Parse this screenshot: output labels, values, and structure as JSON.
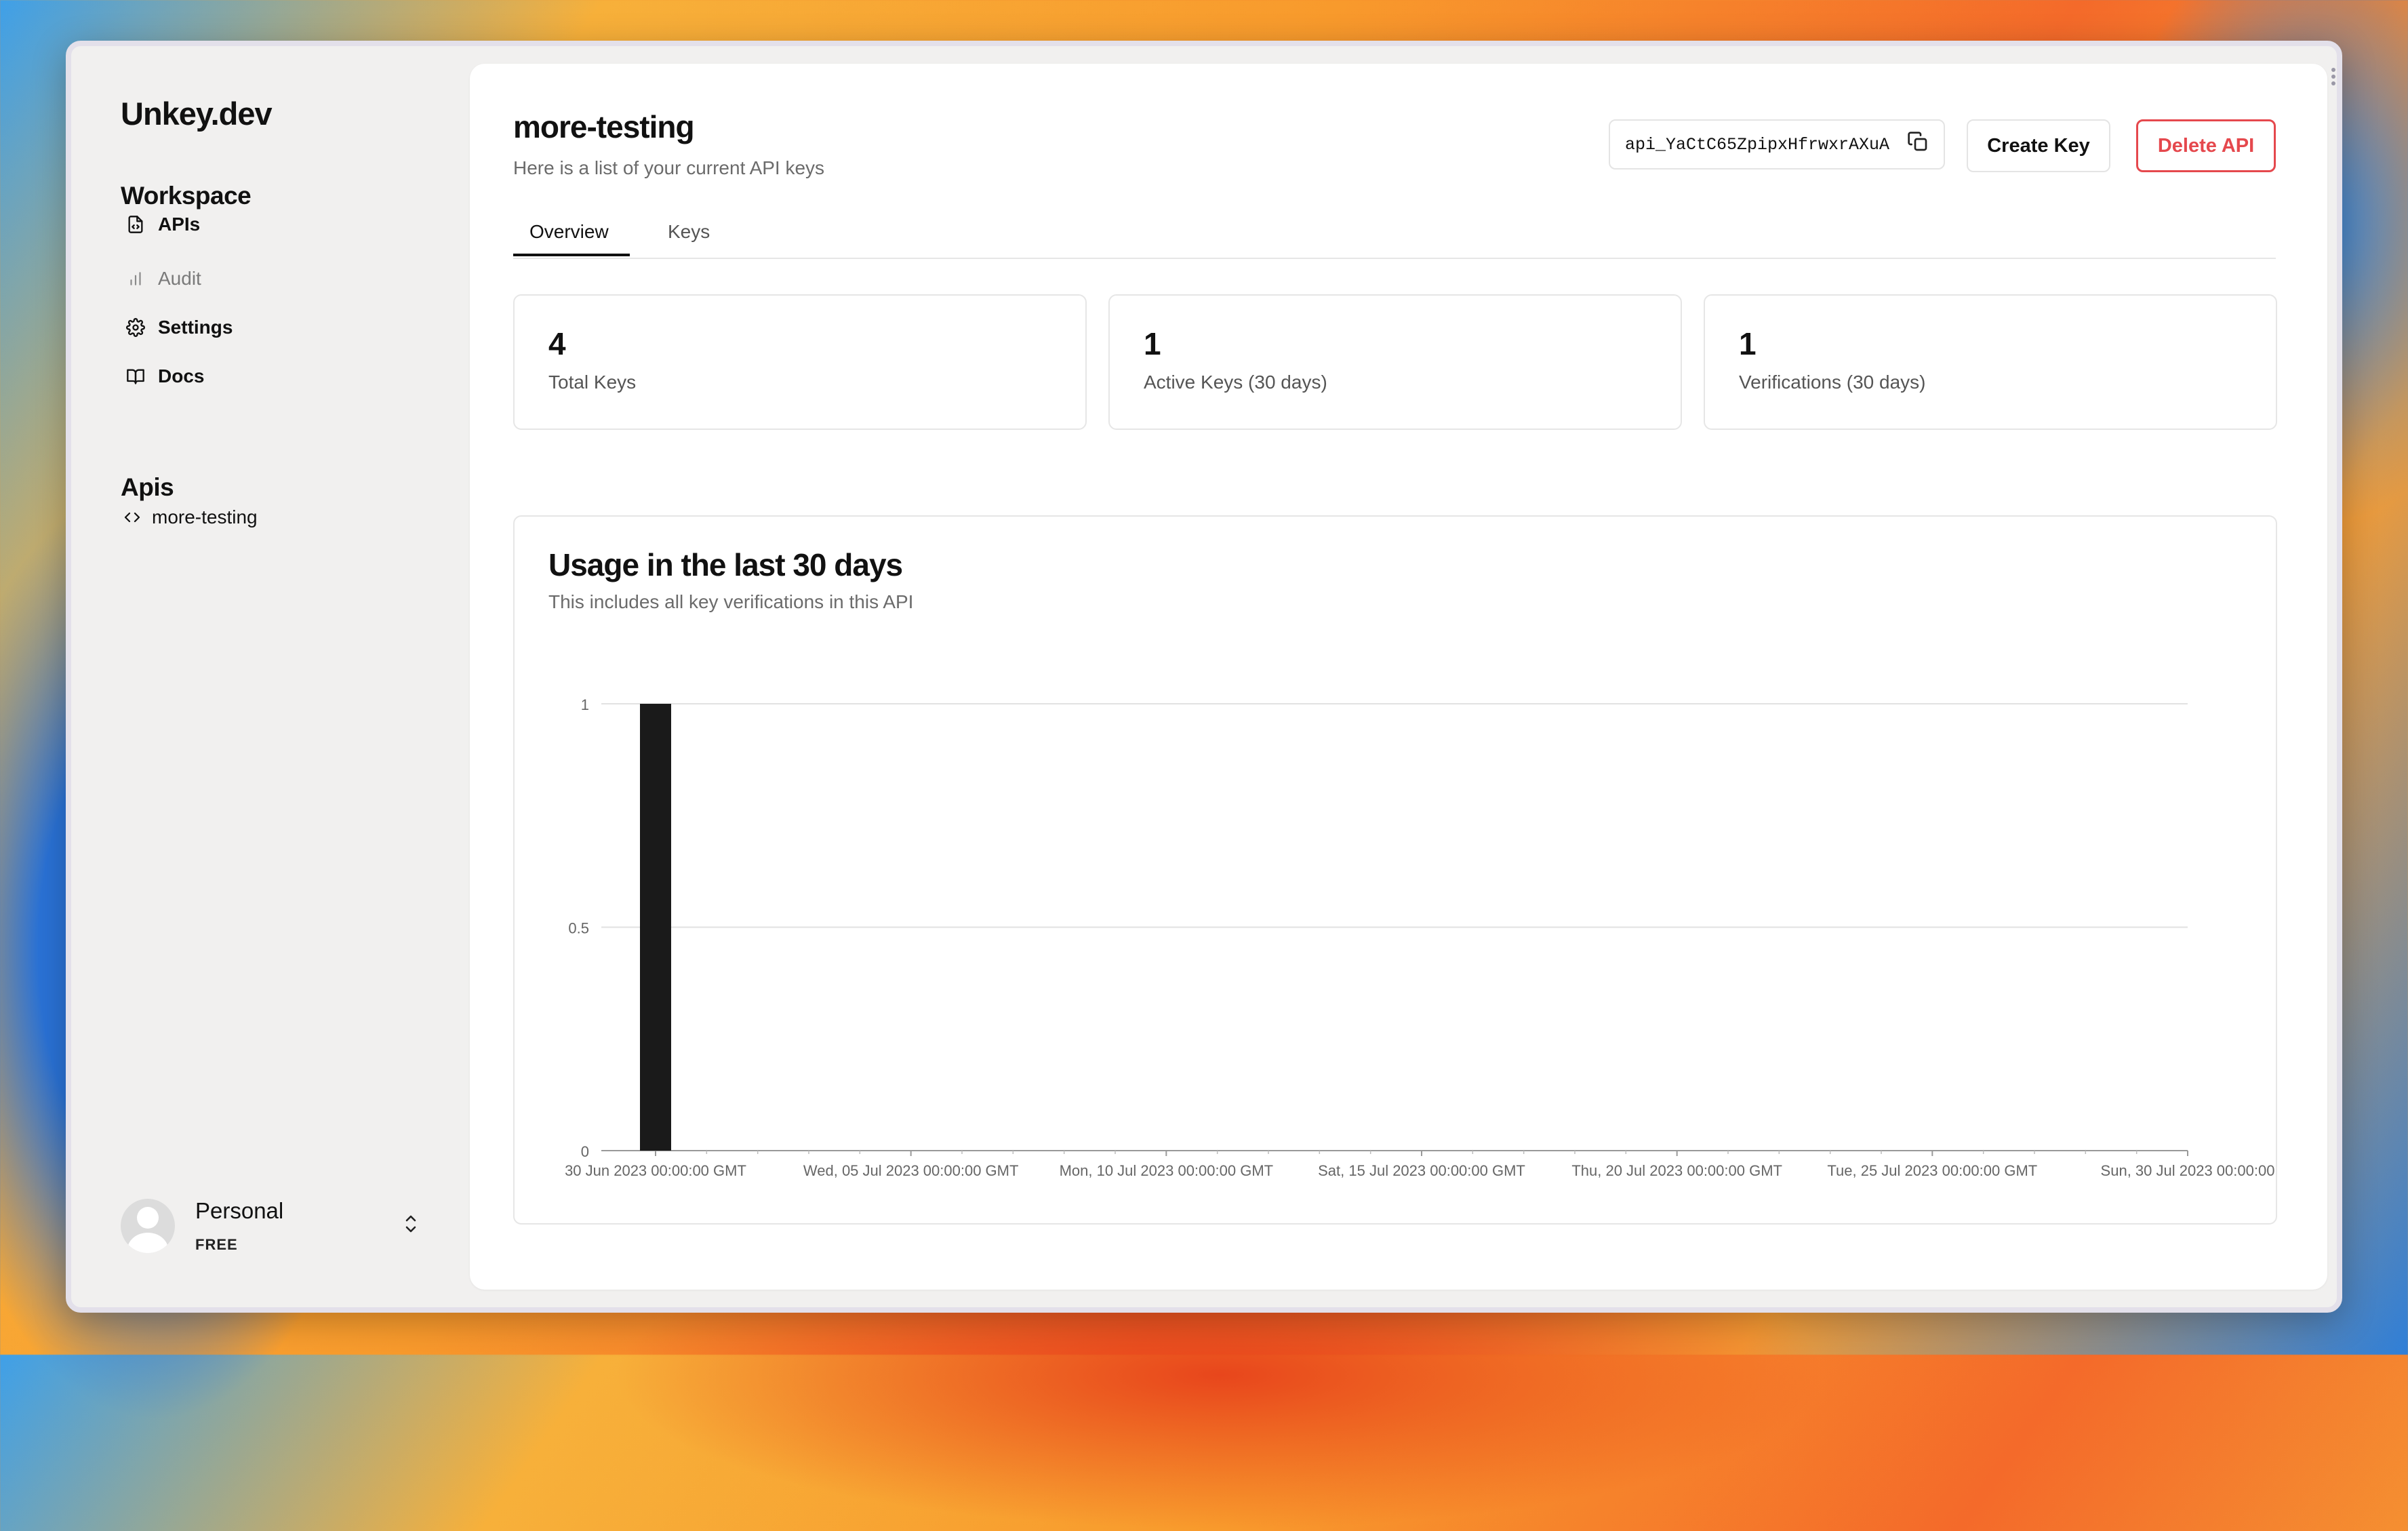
{
  "sidebar": {
    "logo": "Unkey.dev",
    "workspace_title": "Workspace",
    "nav": [
      {
        "label": "APIs",
        "icon": "file-code-icon"
      },
      {
        "label": "Audit",
        "icon": "bar-chart-icon"
      },
      {
        "label": "Settings",
        "icon": "gear-icon"
      },
      {
        "label": "Docs",
        "icon": "book-open-icon"
      }
    ],
    "apis_title": "Apis",
    "apis": [
      {
        "label": "more-testing",
        "icon": "code-brackets-icon"
      }
    ],
    "profile": {
      "name": "Personal",
      "plan": "FREE"
    }
  },
  "header": {
    "title": "more-testing",
    "subtitle": "Here is a list of your current API keys",
    "api_id": "api_YaCtC65ZpipxHfrwxrAXuA",
    "create_key": "Create Key",
    "delete_api": "Delete API"
  },
  "tabs": [
    {
      "label": "Overview",
      "active": true
    },
    {
      "label": "Keys",
      "active": false
    }
  ],
  "stats": [
    {
      "value": "4",
      "label": "Total Keys"
    },
    {
      "value": "1",
      "label": "Active Keys (30 days)"
    },
    {
      "value": "1",
      "label": "Verifications (30 days)"
    }
  ],
  "usage": {
    "title": "Usage in the last 30 days",
    "subtitle": "This includes all key verifications in this API"
  },
  "colors": {
    "accent_danger": "#e5484d",
    "bar": "#1a1a1a",
    "text": "#111111"
  },
  "chart_data": {
    "type": "bar",
    "x": [
      "30 Jun 2023",
      "01 Jul 2023",
      "02 Jul 2023",
      "03 Jul 2023",
      "04 Jul 2023",
      "05 Jul 2023",
      "06 Jul 2023",
      "07 Jul 2023",
      "08 Jul 2023",
      "09 Jul 2023",
      "10 Jul 2023",
      "11 Jul 2023",
      "12 Jul 2023",
      "13 Jul 2023",
      "14 Jul 2023",
      "15 Jul 2023",
      "16 Jul 2023",
      "17 Jul 2023",
      "18 Jul 2023",
      "19 Jul 2023",
      "20 Jul 2023",
      "21 Jul 2023",
      "22 Jul 2023",
      "23 Jul 2023",
      "24 Jul 2023",
      "25 Jul 2023",
      "26 Jul 2023",
      "27 Jul 2023",
      "28 Jul 2023",
      "29 Jul 2023",
      "30 Jul 2023"
    ],
    "values": [
      1,
      0,
      0,
      0,
      0,
      0,
      0,
      0,
      0,
      0,
      0,
      0,
      0,
      0,
      0,
      0,
      0,
      0,
      0,
      0,
      0,
      0,
      0,
      0,
      0,
      0,
      0,
      0,
      0,
      0,
      0
    ],
    "xtick_labels": [
      "30 Jun 2023 00:00:00 GMT",
      "Wed, 05 Jul 2023 00:00:00 GMT",
      "Mon, 10 Jul 2023 00:00:00 GMT",
      "Sat, 15 Jul 2023 00:00:00 GMT",
      "Thu, 20 Jul 2023 00:00:00 GMT",
      "Tue, 25 Jul 2023 00:00:00 GMT",
      "Sun, 30 Jul 2023 00:00:00"
    ],
    "ytick_labels": [
      "0",
      "0.5",
      "1"
    ],
    "ylim": [
      0,
      1
    ],
    "grid": true,
    "legend": "none"
  }
}
